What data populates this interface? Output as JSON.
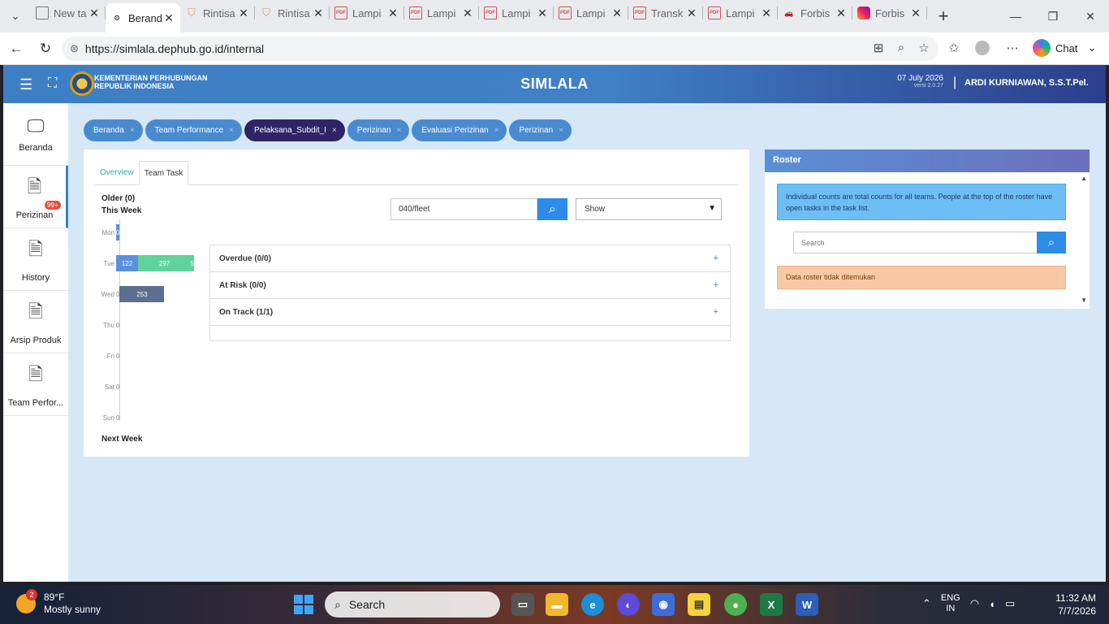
{
  "browser": {
    "tabs": [
      {
        "title": "New ta",
        "icon": "doc-icon"
      },
      {
        "title": "Berand",
        "icon": "ministry-icon",
        "active": true
      },
      {
        "title": "Rintisa",
        "icon": "shield-icon"
      },
      {
        "title": "Rintisa",
        "icon": "shield-icon"
      },
      {
        "title": "Lampi",
        "icon": "pdf-icon"
      },
      {
        "title": "Lampi",
        "icon": "pdf-icon"
      },
      {
        "title": "Lampi",
        "icon": "pdf-icon"
      },
      {
        "title": "Lampi",
        "icon": "pdf-icon"
      },
      {
        "title": "Transk",
        "icon": "pdf-icon"
      },
      {
        "title": "Lampi",
        "icon": "pdf-icon"
      },
      {
        "title": "Forbis",
        "icon": "car-icon"
      },
      {
        "title": "Forbis",
        "icon": "instagram-icon"
      }
    ],
    "url": "https://simlala.dephub.go.id/internal",
    "chat_label": "Chat"
  },
  "header": {
    "ministry_name": "KEMENTERIAN PERHUBUNGAN\nREPUBLIK INDONESIA",
    "app_title": "SIMLALA",
    "date": "07 July 2026",
    "version": "versi 2.0.27",
    "separator": "|",
    "user": "ARDI KURNIAWAN, S.S.T.Pel."
  },
  "sidebar": {
    "items": [
      {
        "label": "Beranda",
        "icon": "monitor-icon"
      },
      {
        "label": "Perizinan",
        "icon": "document-icon",
        "badge": "99+",
        "active": true
      },
      {
        "label": "History",
        "icon": "document-icon"
      },
      {
        "label": "Arsip Produk",
        "icon": "document-icon"
      },
      {
        "label": "Team Perfor...",
        "icon": "document-icon"
      }
    ]
  },
  "page_tabs": [
    {
      "label": "Beranda"
    },
    {
      "label": "Team Performance"
    },
    {
      "label": "Pelaksana_Subdit_I",
      "active": true
    },
    {
      "label": "Perizinan"
    },
    {
      "label": "Evaluasi Perizinan"
    },
    {
      "label": "Perizinan"
    }
  ],
  "main": {
    "tabs": [
      {
        "label": "Overview"
      },
      {
        "label": "Team Task",
        "active": true
      }
    ],
    "older_label": "Older (0)",
    "this_week_label": "This Week",
    "next_week_label": "Next Week",
    "week": [
      {
        "day": "Mon",
        "segments": [
          {
            "value": "0",
            "color": "blue",
            "share": 0.02
          }
        ]
      },
      {
        "day": "Tue",
        "segments": [
          {
            "value": "122",
            "color": "blue",
            "share": 0.28
          },
          {
            "value": "297",
            "color": "green",
            "share": 0.68
          },
          {
            "value": "5",
            "color": "green",
            "share": 0.01
          }
        ]
      },
      {
        "day": "Wed",
        "segments": [
          {
            "value": "0",
            "color": "none",
            "share": 0
          },
          {
            "value": "253",
            "color": "slate",
            "share": 0.58
          }
        ]
      },
      {
        "day": "Thu",
        "segments": [
          {
            "value": "0",
            "color": "none",
            "share": 0
          }
        ]
      },
      {
        "day": "Fri",
        "segments": [
          {
            "value": "0",
            "color": "none",
            "share": 0
          }
        ]
      },
      {
        "day": "Sat",
        "segments": [
          {
            "value": "0",
            "color": "none",
            "share": 0
          }
        ]
      },
      {
        "day": "Sun",
        "segments": [
          {
            "value": "0",
            "color": "none",
            "share": 0
          }
        ]
      }
    ],
    "search_value": "040/fleet",
    "show_select": "Show",
    "status_rows": [
      {
        "label": "Overdue (0/0)"
      },
      {
        "label": "At Risk (0/0)"
      },
      {
        "label": "On Track (1/1)"
      }
    ],
    "plus_symbol": "+"
  },
  "roster": {
    "title": "Roster",
    "info": "Individual counts are total counts for all teams. People at the top of the roster have open tasks in the task list.",
    "search_placeholder": "Search",
    "empty_message": "Data roster tidak ditemukan"
  },
  "taskbar": {
    "weather_temp": "89°F",
    "weather_desc": "Mostly sunny",
    "weather_badge": "2",
    "search_label": "Search",
    "lang_top": "ENG",
    "lang_bottom": "IN",
    "time": "11:32 AM",
    "date": "7/7/2026"
  },
  "colors": {
    "header_start": "#3d7fc5",
    "header_end": "#2c3e8c",
    "active_page_tab": "#2f2466",
    "page_tab": "#4a8bd0",
    "accent_blue": "#2d8ce8",
    "app_background": "#d6e7f8"
  }
}
